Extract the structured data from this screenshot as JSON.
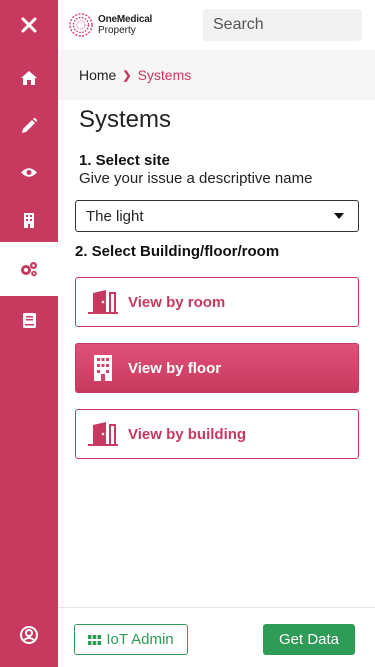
{
  "app": {
    "logo_line1": "OneMedical",
    "logo_line2": "Property",
    "accent_color": "#c8395f",
    "success_color": "#2e9b57"
  },
  "search": {
    "placeholder": "Search"
  },
  "sidebar": {
    "items": [
      {
        "icon": "close-icon"
      },
      {
        "icon": "home-icon"
      },
      {
        "icon": "pencil-icon"
      },
      {
        "icon": "eye-icon"
      },
      {
        "icon": "building-icon"
      },
      {
        "icon": "gears-icon",
        "active": true
      },
      {
        "icon": "book-icon"
      },
      {
        "icon": "user-circle-icon"
      }
    ]
  },
  "breadcrumb": {
    "home": "Home",
    "current": "Systems"
  },
  "main": {
    "title": "Systems",
    "step1_label": "1. Select site",
    "step1_hint": "Give your issue a descriptive name",
    "site_select_value": "The light",
    "step2_label": "2. Select Building/floor/room",
    "views": [
      {
        "label": "View by room",
        "icon": "door-icon"
      },
      {
        "label": "View by floor",
        "icon": "building-icon",
        "selected": true
      },
      {
        "label": "View by building",
        "icon": "door-icon"
      }
    ]
  },
  "footer": {
    "iot_admin_label": "IoT Admin",
    "get_data_label": "Get Data"
  }
}
